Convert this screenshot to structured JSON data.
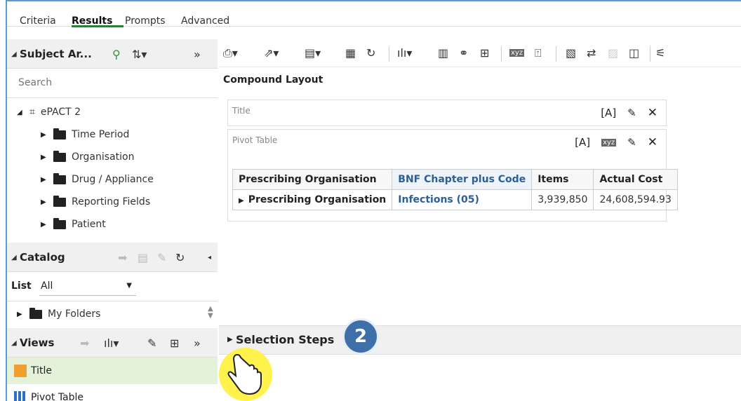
{
  "tabs": [
    "Criteria",
    "Results",
    "Prompts",
    "Advanced"
  ],
  "active_tab": "Results",
  "subject_area": {
    "title": "Subject Ar...",
    "search_placeholder": "Search",
    "root": "ePACT 2",
    "folders": [
      "Time Period",
      "Organisation",
      "Drug / Appliance",
      "Reporting Fields",
      "Patient"
    ]
  },
  "catalog": {
    "title": "Catalog",
    "list_label": "List",
    "list_value": "All",
    "folders": [
      "My Folders"
    ]
  },
  "views": {
    "title": "Views",
    "items": [
      "Title",
      "Pivot Table"
    ]
  },
  "compound_layout": {
    "title": "Compound Layout",
    "title_view_label": "Title",
    "pivot_view_label": "Pivot Table",
    "xyz_icon_text": "xyz"
  },
  "pivot": {
    "headers": [
      "Prescribing Organisation",
      "BNF Chapter plus Code",
      "Items",
      "Actual Cost"
    ],
    "row": {
      "org": "Prescribing Organisation",
      "bnf": "Infections (05)",
      "items": "3,939,850",
      "cost": "24,608,594.93"
    }
  },
  "selection_steps": {
    "title": "Selection Steps"
  },
  "step_badge": "2",
  "colors": {
    "accent_green": "#2e7d32",
    "link_blue": "#2a5f98",
    "badge_blue": "#3f6fa9",
    "highlight_yellow": "#fff24d"
  }
}
